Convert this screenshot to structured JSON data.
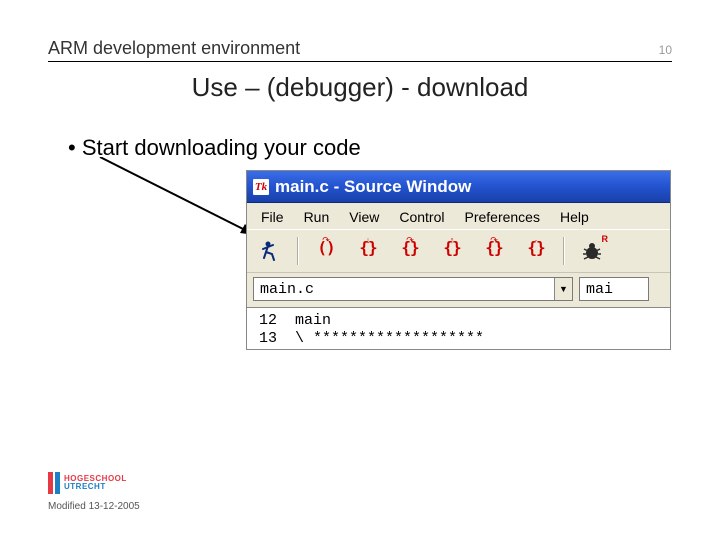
{
  "header": {
    "title": "ARM development environment",
    "page": "10"
  },
  "subtitle": "Use – (debugger) - download",
  "bullet_text": "Start downloading your code",
  "window": {
    "title": "main.c - Source Window",
    "icon_text": "Tk"
  },
  "menu": {
    "file": "File",
    "run": "Run",
    "view": "View",
    "control": "Control",
    "preferences": "Preferences",
    "help": "Help"
  },
  "toolbar": {
    "paren_round": "()",
    "paren_curly_a": "{}",
    "paren_curly_b": "{}",
    "paren_curly_up": "{}",
    "paren_curly_c": "{}",
    "paren_curly_dot": "{}",
    "over_arrow": "↷",
    "over_down": "↓",
    "over_up": "↑",
    "over_dot": "·",
    "bug_badge": "R"
  },
  "combo": {
    "filename": "main.c",
    "rightfield": "mai"
  },
  "code": {
    "line12_num": "12",
    "line12_text": "main",
    "line13_num": "13",
    "line13_text": "\\ *******************"
  },
  "footer": {
    "logo_top": "HOGESCHOOL",
    "logo_bottom": "UTRECHT",
    "modified": "Modified 13-12-2005"
  }
}
